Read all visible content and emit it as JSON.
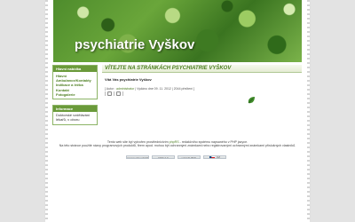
{
  "header": {
    "title": "psychiatrie Vyškov"
  },
  "sidebar": {
    "menu_title": "Hlavní nabídka",
    "menu_items": [
      "Hlavní",
      "Ambulance/Kontakty",
      "Indikace a léčba",
      "Kontakt",
      "Fotogalerie"
    ],
    "info_title": "Informace",
    "info_text": "Doktorské vzdělávání lékařů, v oboru"
  },
  "main": {
    "heading": "VÍTEJTE NA STRÁNKÁCH PSYCHIATRIE VYŠKOV",
    "article_title": "Vítá Vás psychiatrie Vyškov",
    "meta_prefix": "[ Autor :",
    "meta_author": "administrator",
    "meta_suffix": "| Vydáno dne 09. 11. 2012 | 2044 přečtení ]"
  },
  "footer": {
    "line1_before": "Tento web site byl vytvořen prostřednictvím",
    "line1_link": "phpRS",
    "line1_after": "- redakčního systému napsaného v PHP jazyce.",
    "line2": "Na této stránce použité názvy programových produktů, firem apod. mohou být ochrannými známkami nebo registrovanými ochrannými známkami příslušných vlastníků.",
    "badges": [
      "powered by phpRS",
      "RSS 2.0",
      "valid XHTML",
      "CZ"
    ]
  },
  "colors": {
    "accent": "#4b7d1f",
    "header_green": "#6a9a3a"
  },
  "icons": [
    "print-icon",
    "email-icon",
    "leaf-icon"
  ]
}
